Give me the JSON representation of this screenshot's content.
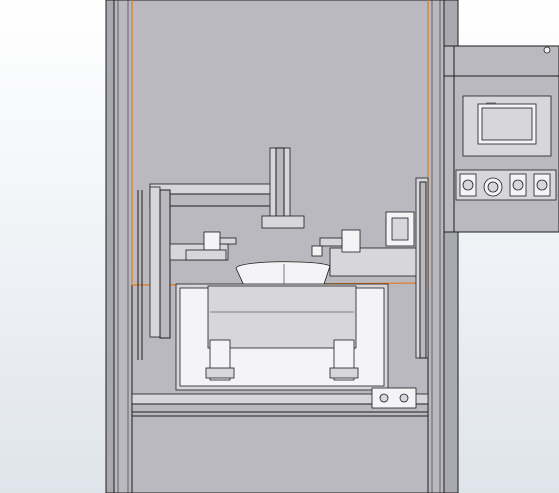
{
  "viewport": {
    "view": "front",
    "colors": {
      "background_top": "#ffffff",
      "background_bottom": "#dfe4eb",
      "frame": "#b9b9bf",
      "edge": "#1f1f1f",
      "highlight": "#e07b21"
    }
  },
  "control_panel": {
    "screen": "touchscreen-hmi",
    "buttons": [
      "button",
      "selector-switch",
      "button",
      "button",
      "button"
    ]
  }
}
